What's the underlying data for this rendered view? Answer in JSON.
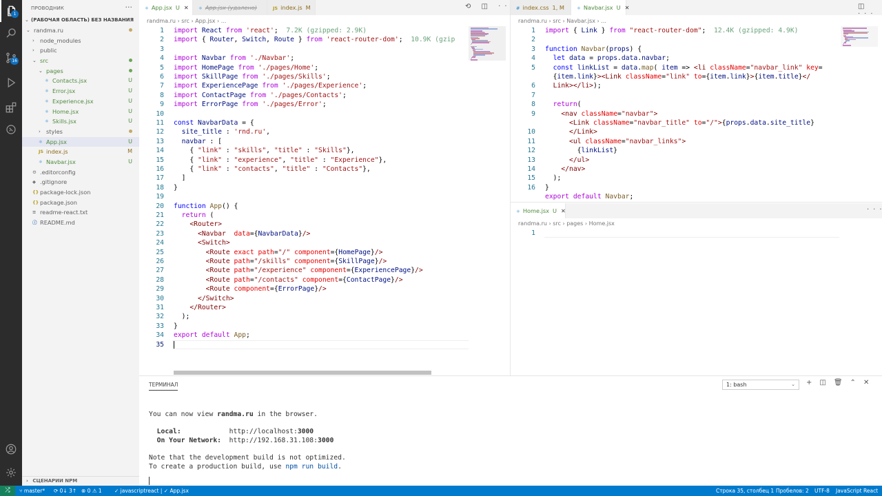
{
  "activity_bar": {
    "scm_badge": "16",
    "explorer_badge": "1"
  },
  "sidebar": {
    "title": "ПРОВОДНИК",
    "workspace": "(РАБОЧАЯ ОБЛАСТЬ) БЕЗ НАЗВАНИЯ",
    "bottom_section": "СЦЕНАРИИ NPM",
    "items": [
      {
        "name": "randma.ru",
        "kind": "folder-open",
        "indent": 0,
        "status": "dot"
      },
      {
        "name": "node_modules",
        "kind": "folder",
        "indent": 1,
        "status": ""
      },
      {
        "name": "public",
        "kind": "folder",
        "indent": 1,
        "status": ""
      },
      {
        "name": "src",
        "kind": "folder-open",
        "indent": 1,
        "status": "dot-green"
      },
      {
        "name": "pages",
        "kind": "folder-open",
        "indent": 2,
        "status": "dot-green"
      },
      {
        "name": "Contacts.jsx",
        "kind": "jsx",
        "indent": 3,
        "status": "U"
      },
      {
        "name": "Error.jsx",
        "kind": "jsx",
        "indent": 3,
        "status": "U"
      },
      {
        "name": "Experience.jsx",
        "kind": "jsx",
        "indent": 3,
        "status": "U"
      },
      {
        "name": "Home.jsx",
        "kind": "jsx",
        "indent": 3,
        "status": "U"
      },
      {
        "name": "Skills.jsx",
        "kind": "jsx",
        "indent": 3,
        "status": "U"
      },
      {
        "name": "styles",
        "kind": "folder",
        "indent": 2,
        "status": "dot"
      },
      {
        "name": "App.jsx",
        "kind": "jsx",
        "indent": 2,
        "status": "U",
        "selected": true
      },
      {
        "name": "index.js",
        "kind": "js",
        "indent": 2,
        "status": "M"
      },
      {
        "name": "Navbar.jsx",
        "kind": "jsx",
        "indent": 2,
        "status": "U"
      },
      {
        "name": ".editorconfig",
        "kind": "config",
        "indent": 1,
        "status": ""
      },
      {
        "name": ".gitignore",
        "kind": "git",
        "indent": 1,
        "status": ""
      },
      {
        "name": "package-lock.json",
        "kind": "json",
        "indent": 1,
        "status": ""
      },
      {
        "name": "package.json",
        "kind": "json",
        "indent": 1,
        "status": ""
      },
      {
        "name": "readme-react.txt",
        "kind": "txt",
        "indent": 1,
        "status": ""
      },
      {
        "name": "README.md",
        "kind": "md",
        "indent": 1,
        "status": ""
      }
    ]
  },
  "left_editor": {
    "tabs": [
      {
        "label": "App.jsx",
        "status": "U",
        "icon": "react",
        "active": true
      },
      {
        "label": "App.jsx (удалено)",
        "status": "",
        "icon": "react",
        "deleted": true
      },
      {
        "label": "index.js",
        "status": "M",
        "icon": "js"
      }
    ],
    "breadcrumb": "randma.ru › src › App.jsx › ...",
    "lines": [
      "<k>import</k> <v>React</v> <k>from</k> <s>'react'</s>;  <h>7.2K (gzipped: 2.9K)</h>",
      "<k>import</k> { <v>Router</v>, <v>Switch</v>, <v>Route</v> } <k>from</k> <s>'react-router-dom'</s>;  <h>10.9K (gzip</h>",
      "",
      "<k>import</k> <v>Navbar</v> <k>from</k> <s>'./Navbar'</s>;",
      "<k>import</k> <v>HomePage</v> <k>from</k> <s>'./pages/Home'</s>;",
      "<k>import</k> <v>SkillPage</v> <k>from</k> <s>'./pages/Skills'</s>;",
      "<k>import</k> <v>ExperiencePage</v> <k>from</k> <s>'./pages/Experience'</s>;",
      "<k>import</k> <v>ContactPage</v> <k>from</k> <s>'./pages/Contacts'</s>;",
      "<k>import</k> <v>ErrorPage</v> <k>from</k> <s>'./pages/Error'</s>;",
      "",
      "<b>const</b> <v>NavbarData</v> = {",
      "  <v>site_title</v> : <s>'rnd.ru'</s>,",
      "  <v>navbar</v> : [",
      "    { <s>\"link\"</s> : <s>\"skills\"</s>, <s>\"title\"</s> : <s>\"Skills\"</s>},",
      "    { <s>\"link\"</s> : <s>\"experience\"</s>, <s>\"title\"</s> : <s>\"Experience\"</s>},",
      "    { <s>\"link\"</s> : <s>\"contacts\"</s>, <s>\"title\"</s> : <s>\"Contacts\"</s>},",
      "  ]",
      "}",
      "",
      "<b>function</b> <f>App</f>() {",
      "  <p>return</p> (",
      "    <t>&lt;Router&gt;</t>",
      "      <t>&lt;Navbar</t>  <a>data</a>={<v>NavbarData</v>}<t>/&gt;</t>",
      "      <t>&lt;Switch&gt;</t>",
      "        <t>&lt;Route</t> <a>exact</a> <a>path</a>=<s>\"/\"</s> <a>component</a>={<v>HomePage</v>}<t>/&gt;</t>",
      "        <t>&lt;Route</t> <a>path</a>=<s>\"/skills\"</s> <a>component</a>={<v>SkillPage</v>}<t>/&gt;</t>",
      "        <t>&lt;Route</t> <a>path</a>=<s>\"/experience\"</s> <a>component</a>={<v>ExperiencePage</v>}<t>/&gt;</t>",
      "        <t>&lt;Route</t> <a>path</a>=<s>\"/contacts\"</s> <a>component</a>={<v>ContactPage</v>}<t>/&gt;</t>",
      "        <t>&lt;Route</t> <a>component</a>={<v>ErrorPage</v>}<t>/&gt;</t>",
      "      <t>&lt;/Switch&gt;</t>",
      "    <t>&lt;/Router&gt;</t>",
      "  );",
      "}",
      "<p>export</p> <p>default</p> <f>App</f>;",
      ""
    ],
    "current_line": 35
  },
  "right_top_editor": {
    "tabs": [
      {
        "label": "index.css",
        "status": "1, M",
        "icon": "css"
      },
      {
        "label": "Navbar.jsx",
        "status": "U",
        "icon": "react",
        "active": true
      }
    ],
    "breadcrumb": "randma.ru › src › Navbar.jsx › ...",
    "line_numbers": [
      "1",
      "2",
      "3",
      "4",
      "5",
      "",
      "6",
      "7",
      "8",
      "9",
      "",
      "10",
      "11",
      "12",
      "13",
      "14",
      "15",
      "16"
    ],
    "lines": [
      "<k>import</k> { <v>Link</v> } <k>from</k> <s>\"react-router-dom\"</s>;  <h>12.4K (gzipped: 4.9K)</h>",
      "",
      "<b>function</b> <f>Navbar</f>(<v>props</v>) {",
      "  <b>let</b> <v>data</v> = <v>props</v>.<v>data</v>.<v>navbar</v>;",
      "  <b>const</b> <v>linkList</v> = <v>data</v>.<f>map</f>( <v>item</v> =&gt; <t>&lt;li</t> <a>className</a>=<s>\"navbar_link\"</s> <a>key</a>=",
      "  {<v>item</v>.<v>link</v>}<t>&gt;&lt;Link</t> <a>className</a>=<s>\"link\"</s> <a>to</a>={<v>item</v>.<v>link</v>}<t>&gt;</t>{<v>item</v>.<v>title</v>}<t>&lt;/</t>",
      "  <t>Link&gt;&lt;/li&gt;</t>);",
      "",
      "  <p>return</p>(",
      "    <t>&lt;nav</t> <a>className</a>=<s>\"navbar\"</s><t>&gt;</t>",
      "      <t>&lt;Link</t> <a>className</a>=<s>\"navbar_title\"</s> <a>to</a>=<s>\"/\"</s><t>&gt;</t>{<v>props</v>.<v>data</v>.<v>site_title</v>}",
      "      <t>&lt;/Link&gt;</t>",
      "      <t>&lt;ul</t> <a>className</a>=<s>\"navbar_links\"</s><t>&gt;</t>",
      "        {<v>linkList</v>}",
      "      <t>&lt;/ul&gt;</t>",
      "    <t>&lt;/nav&gt;</t>",
      "  );",
      "}",
      "<p>export</p> <p>default</p> <f>Navbar</f>;"
    ]
  },
  "right_bottom_editor": {
    "tabs": [
      {
        "label": "Home.jsx",
        "status": "U",
        "icon": "react",
        "active": true
      }
    ],
    "breadcrumb": "randma.ru › src › pages › Home.jsx",
    "line_numbers": [
      "1"
    ]
  },
  "terminal": {
    "tab_label": "ТЕРМИНАЛ",
    "shell_select": "1: bash",
    "lines": [
      "",
      "",
      "You can now view <b>randma.ru</b> in the browser.",
      "",
      "  <b>Local:</b>            http://localhost:<b>3000</b>",
      "  <b>On Your Network:</b>  http://192.168.31.108:<b>3000</b>",
      "",
      "Note that the development build is not optimized.",
      "To create a production build, use <c>npm run build</c>."
    ]
  },
  "status_bar": {
    "branch": "master*",
    "sync": "0↓ 3↑",
    "problems": "⊗ 0 ⚠ 1",
    "language_path": "javascriptreact | ✓ App.jsx",
    "position": "Строка 35, столбец 1",
    "spaces": "Пробелов: 2",
    "encoding": "UTF-8",
    "language": "JavaScript React"
  },
  "colors": {
    "status_bar": "#007acc",
    "activity_bar": "#2c2c2c",
    "sidebar": "#f3f3f3",
    "git_untracked": "#4f8a3e",
    "git_modified": "#8f6c1f"
  }
}
